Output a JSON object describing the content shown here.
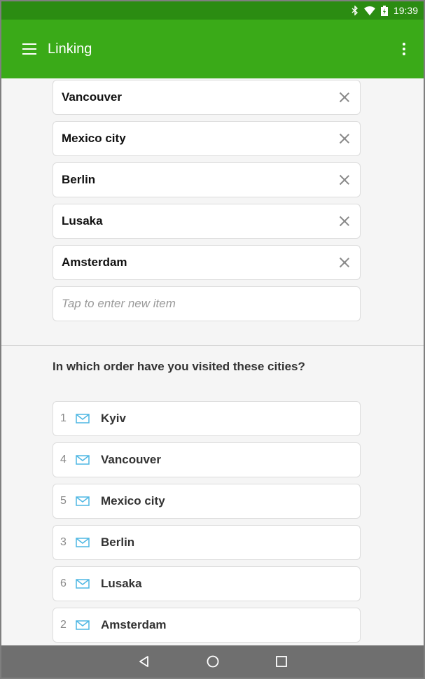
{
  "status_bar": {
    "time": "19:39"
  },
  "app_bar": {
    "title": "Linking"
  },
  "tags": [
    {
      "label": "Vancouver"
    },
    {
      "label": "Mexico city"
    },
    {
      "label": "Berlin"
    },
    {
      "label": "Lusaka"
    },
    {
      "label": "Amsterdam"
    }
  ],
  "new_item": {
    "placeholder": "Tap to enter new item",
    "value": ""
  },
  "question": "In which order have you visited these cities?",
  "ranking": [
    {
      "number": "1",
      "label": "Kyiv"
    },
    {
      "number": "4",
      "label": "Vancouver"
    },
    {
      "number": "5",
      "label": "Mexico city"
    },
    {
      "number": "3",
      "label": "Berlin"
    },
    {
      "number": "6",
      "label": "Lusaka"
    },
    {
      "number": "2",
      "label": "Amsterdam"
    }
  ],
  "colors": {
    "status_bar": "#2b8c12",
    "app_bar": "#3aaa18",
    "nav_bar": "#6f6f6f",
    "rank_icon": "#4fb7e3"
  },
  "icons": {
    "status": [
      "bluetooth-icon",
      "wifi-icon",
      "battery-icon"
    ],
    "app_bar": [
      "menu-icon",
      "overflow-menu-icon"
    ],
    "nav": [
      "back-icon",
      "home-icon",
      "recents-icon"
    ],
    "tag_remove": "close-icon",
    "rank": "order-icon"
  }
}
